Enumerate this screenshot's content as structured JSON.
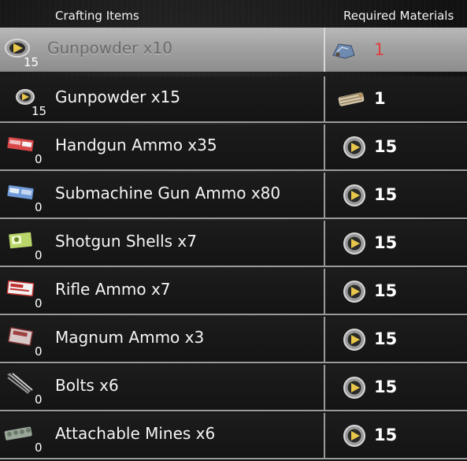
{
  "header": {
    "crafting_items": "Crafting Items",
    "required_materials": "Required Materials"
  },
  "rows": [
    {
      "name": "Gunpowder x10",
      "qty": "15",
      "icon": "gunpowder-icon",
      "material_icon": "cloth-icon",
      "material_count": "1",
      "selected": true
    },
    {
      "name": "Gunpowder x15",
      "qty": "15",
      "icon": "gunpowder-icon",
      "material_icon": "wire-bundle-icon",
      "material_count": "1"
    },
    {
      "name": "Handgun Ammo x35",
      "qty": "0",
      "icon": "handgun-ammo-icon",
      "material_icon": "gunpowder-icon",
      "material_count": "15"
    },
    {
      "name": "Submachine Gun Ammo x80",
      "qty": "0",
      "icon": "smg-ammo-icon",
      "material_icon": "gunpowder-icon",
      "material_count": "15"
    },
    {
      "name": "Shotgun Shells x7",
      "qty": "0",
      "icon": "shotgun-shells-icon",
      "material_icon": "gunpowder-icon",
      "material_count": "15"
    },
    {
      "name": "Rifle Ammo x7",
      "qty": "0",
      "icon": "rifle-ammo-icon",
      "material_icon": "gunpowder-icon",
      "material_count": "15"
    },
    {
      "name": "Magnum Ammo x3",
      "qty": "0",
      "icon": "magnum-ammo-icon",
      "material_icon": "gunpowder-icon",
      "material_count": "15"
    },
    {
      "name": "Bolts x6",
      "qty": "0",
      "icon": "bolts-icon",
      "material_icon": "gunpowder-icon",
      "material_count": "15"
    },
    {
      "name": "Attachable Mines x6",
      "qty": "0",
      "icon": "mines-icon",
      "material_icon": "gunpowder-icon",
      "material_count": "15"
    }
  ],
  "colors": {
    "selected_row": "#a8a8a8",
    "row_border": "#9a9a9a",
    "insufficient_count": "#e04040",
    "gunpowder_accent": "#e8c64a"
  }
}
